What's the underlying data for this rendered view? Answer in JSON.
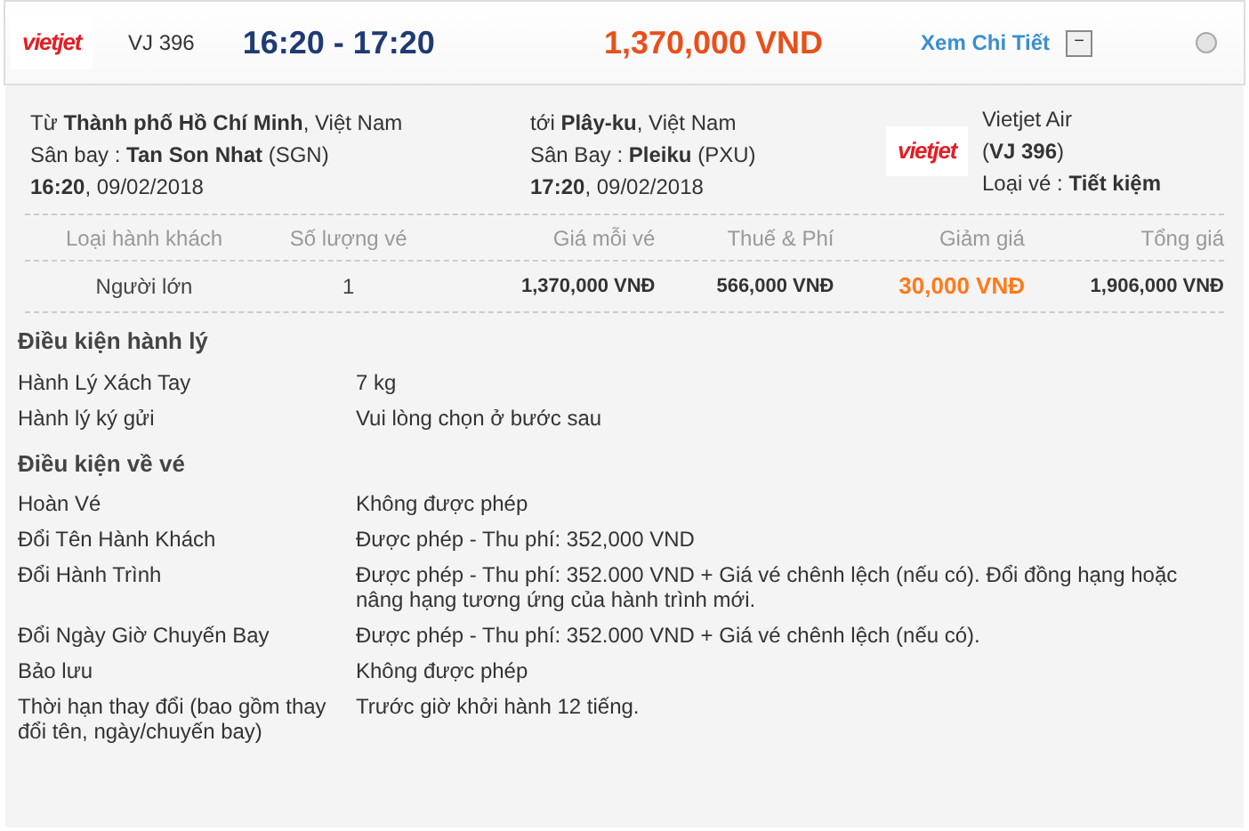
{
  "flight": {
    "logo": "vietjet",
    "code": "VJ 396",
    "times": "16:20 - 17:20",
    "price": "1,370,000 VND",
    "details_link": "Xem Chi Tiết",
    "collapse_toggle": "−",
    "selected": false
  },
  "route": {
    "from": [
      "Từ **Thành phố Hồ Chí Minh**, Việt Nam",
      "Sân bay : **Tan Son Nhat** (SGN)",
      "**16:20**, 09/02/2018"
    ],
    "to": [
      "tới **Plây-ku**, Việt Nam",
      "Sân Bay : **Pleiku** (PXU)",
      "**17:20**, 09/02/2018"
    ],
    "airline_logo": "vietjet",
    "airline": [
      "Vietjet Air",
      "(**VJ 396**)",
      "Loại vé : **Tiết kiệm**"
    ]
  },
  "fare_table": {
    "columns": [
      "Loại hành khách",
      "Số lượng vé",
      "Giá mỗi vé",
      "Thuế & Phí",
      "Giảm giá",
      "Tổng giá"
    ],
    "rows": [
      {
        "cells": [
          "Người lớn",
          "1",
          "1,370,000 VNĐ",
          "566,000 VNĐ",
          "30,000 VNĐ",
          "1,906,000 VNĐ"
        ]
      }
    ]
  },
  "sections": [
    {
      "title": "Điều kiện hành lý",
      "rows": [
        {
          "label": "Hành Lý Xách Tay",
          "value": "7 kg"
        },
        {
          "label": "Hành lý ký gửi",
          "value": "Vui lòng chọn ở bước sau"
        }
      ]
    },
    {
      "title": "Điều kiện về vé",
      "rows": [
        {
          "label": "Hoàn Vé",
          "value": "Không được phép"
        },
        {
          "label": "Đổi Tên Hành Khách",
          "value": "Được phép - Thu phí: 352,000 VND"
        },
        {
          "label": "Đổi Hành Trình",
          "value": "Được phép - Thu phí: 352.000 VND + Giá vé chênh lệch (nếu có). Đổi đồng hạng hoặc nâng hạng tương ứng của hành trình mới."
        },
        {
          "label": "Đổi Ngày Giờ Chuyến Bay",
          "value": "Được phép - Thu phí: 352.000 VND + Giá vé chênh lệch (nếu có)."
        },
        {
          "label": "Bảo lưu",
          "value": "Không được phép"
        },
        {
          "label": "Thời hạn thay đổi (bao gồm thay đổi tên, ngày/chuyến bay)",
          "value": "Trước giờ khởi hành 12 tiếng."
        }
      ]
    }
  ]
}
